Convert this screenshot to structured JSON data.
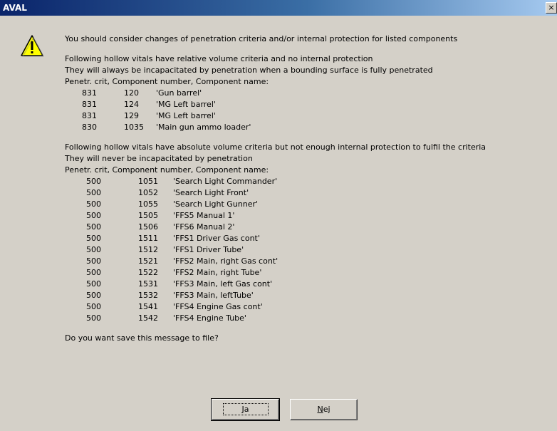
{
  "window": {
    "title": "AVAL",
    "close_label": "×"
  },
  "message": {
    "intro": "You should consider changes of penetration criteria and/or internal protection for listed components",
    "group1": {
      "lines": [
        "Following hollow vitals have relative volume criteria and no internal protection",
        "They will always be incapacitated by penetration when a bounding surface is fully penetrated",
        "Penetr. crit, Component number, Component name:"
      ],
      "rows": [
        [
          "831",
          "120",
          "'Gun barrel'"
        ],
        [
          "831",
          "124",
          "'MG Left barrel'"
        ],
        [
          "831",
          "129",
          "'MG Left barrel'"
        ],
        [
          "830",
          "1035",
          "'Main gun ammo loader'"
        ]
      ]
    },
    "group2": {
      "lines": [
        "Following hollow vitals have absolute volume criteria but not enough internal protection to fulfil the criteria",
        "They will never be incapacitated by penetration",
        "Penetr. crit, Component number, Component name:"
      ],
      "rows": [
        [
          "500",
          "1051",
          "'Search Light Commander'"
        ],
        [
          "500",
          "1052",
          "'Search Light Front'"
        ],
        [
          "500",
          "1055",
          "'Search Light Gunner'"
        ],
        [
          "500",
          "1505",
          "'FFS5 Manual 1'"
        ],
        [
          "500",
          "1506",
          "'FFS6 Manual 2'"
        ],
        [
          "500",
          "1511",
          "'FFS1 Driver Gas cont'"
        ],
        [
          "500",
          "1512",
          "'FFS1 Driver Tube'"
        ],
        [
          "500",
          "1521",
          "'FFS2 Main, right Gas cont'"
        ],
        [
          "500",
          "1522",
          "'FFS2 Main, right Tube'"
        ],
        [
          "500",
          "1531",
          "'FFS3 Main, left Gas cont'"
        ],
        [
          "500",
          "1532",
          "'FFS3 Main, leftTube'"
        ],
        [
          "500",
          "1541",
          "'FFS4 Engine Gas cont'"
        ],
        [
          "500",
          "1542",
          "'FFS4 Engine Tube'"
        ]
      ]
    },
    "question": "Do you want save this message to file?"
  },
  "buttons": {
    "yes": {
      "mnemonic": "J",
      "rest": "a"
    },
    "no": {
      "mnemonic": "N",
      "rest": "ej"
    }
  },
  "icons": {
    "warning": "warning-icon",
    "close": "close-icon"
  }
}
